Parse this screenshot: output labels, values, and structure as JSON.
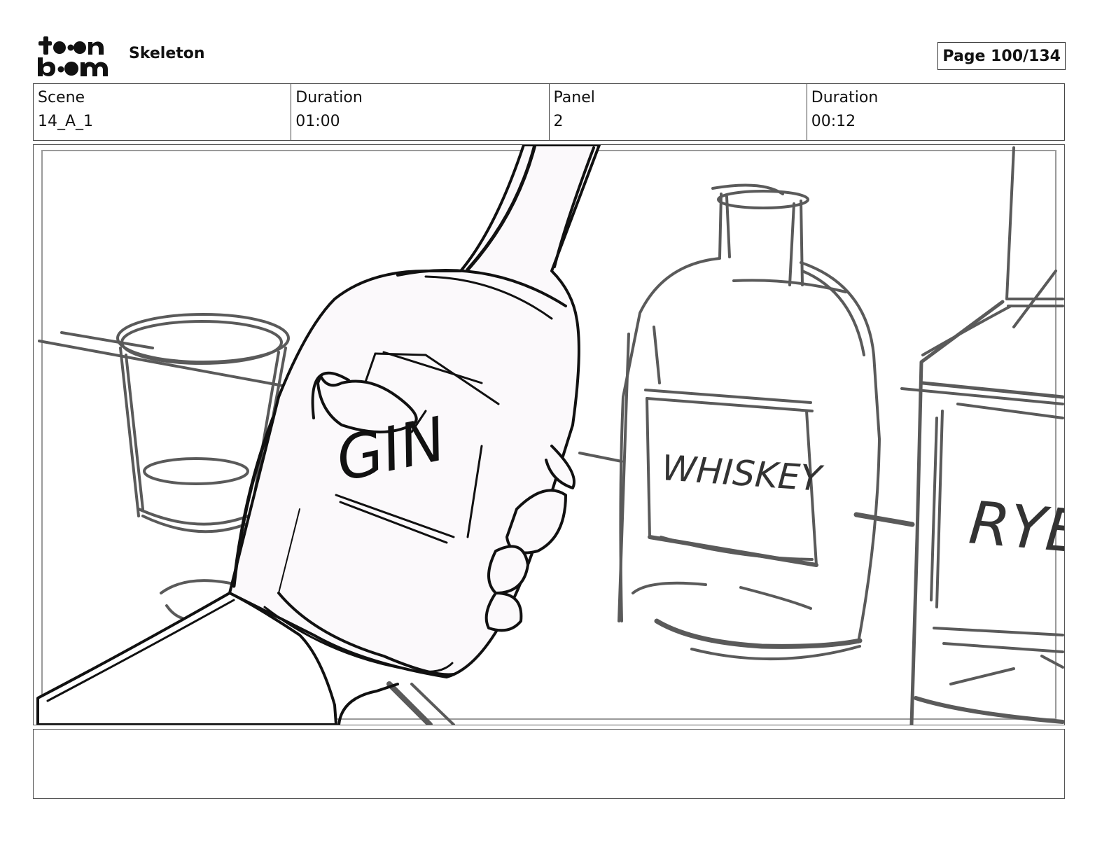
{
  "header": {
    "logo_text": "toon boom",
    "project_title": "Skeleton",
    "page_label": "Page 100/134"
  },
  "info": {
    "scene_label": "Scene",
    "scene_value": "14_A_1",
    "scene_duration_label": "Duration",
    "scene_duration_value": "01:00",
    "panel_label": "Panel",
    "panel_value": "2",
    "panel_duration_label": "Duration",
    "panel_duration_value": "00:12"
  },
  "panel_sketch": {
    "label_gin": "GIN",
    "label_whiskey": "WHISKEY",
    "label_rye": "RYE",
    "colors": {
      "ink_dark": "#111111",
      "ink_grey": "#5a5a5a",
      "bottle_fill": "#fbf9fb"
    }
  },
  "notes": {
    "text": ""
  }
}
